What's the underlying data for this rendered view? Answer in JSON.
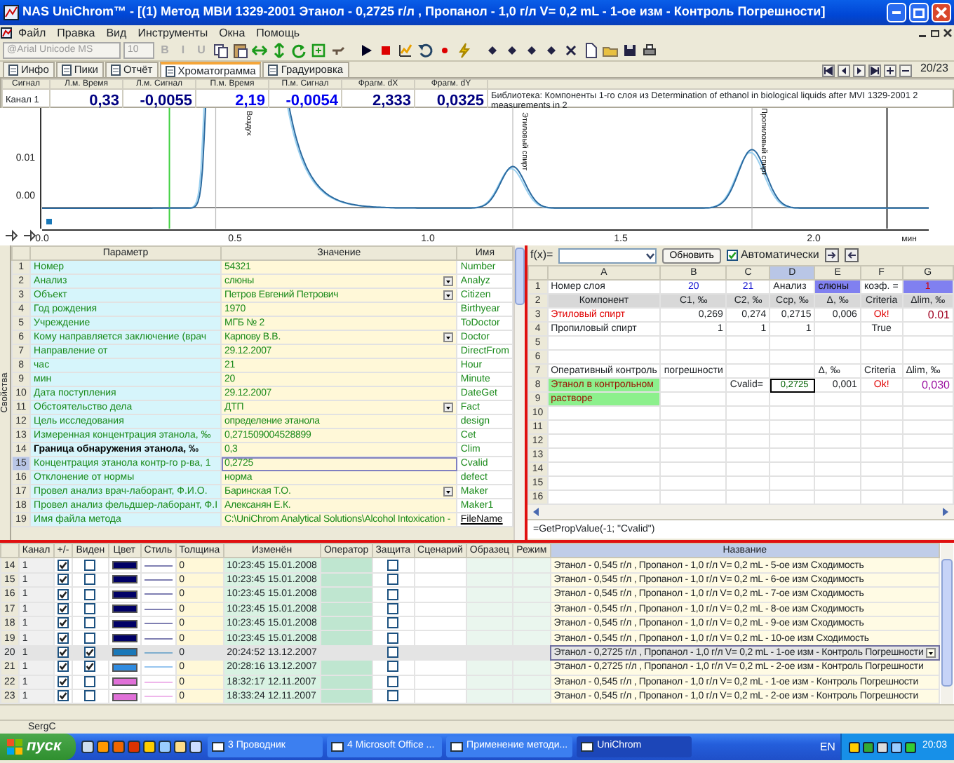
{
  "window": {
    "title": "NAS UniChrom™ - [(1) Метод МВИ 1329-2001   Этанол - 0,2725 г/л , Пропанол - 1,0 г/л V= 0,2 mL - 1-ое изм - Контроль Погрешности]"
  },
  "menu": [
    "Файл",
    "Правка",
    "Вид",
    "Инструменты",
    "Окна",
    "Помощь"
  ],
  "toolbar": {
    "font": "@Arial Unicode MS",
    "size": "10",
    "format_buttons": [
      "B",
      "I",
      "U"
    ]
  },
  "tabs": [
    {
      "label": "Инфо",
      "selected": false
    },
    {
      "label": "Пики",
      "selected": false
    },
    {
      "label": "Отчёт",
      "selected": false
    },
    {
      "label": "Хроматограмма",
      "selected": true
    },
    {
      "label": "Градуировка",
      "selected": false
    }
  ],
  "counter": "20/23",
  "readout": {
    "label_header": "Сигнал",
    "label": "Канал 1",
    "cells": [
      {
        "header": "Л.м. Время",
        "value": "0,33",
        "kind": "left"
      },
      {
        "header": "Л.м. Сигнал",
        "value": "-0,0055",
        "kind": "left"
      },
      {
        "header": "П.м. Время",
        "value": "2,19",
        "kind": "right"
      },
      {
        "header": "П.м. Сигнал",
        "value": "-0,0054",
        "kind": "right"
      },
      {
        "header": "Фрагм. dX",
        "value": "2,333",
        "kind": "left"
      },
      {
        "header": "Фрагм. dY",
        "value": "0,0325",
        "kind": "left"
      }
    ],
    "library": "Библиотека: Компоненты 1-го слоя из Determination of ethanol in biological liquids after MVI 1329-2001 2 measurements in 2"
  },
  "chromatogram": {
    "y_ticks": [
      "0.01",
      "0.00"
    ],
    "x_ticks": [
      "0.0",
      "0.5",
      "1.0",
      "1.5",
      "2.0"
    ],
    "x_unit": "мин",
    "peaks": [
      "Воздух",
      "Этиловый спирт",
      "Пропиловый спирт"
    ]
  },
  "properties": {
    "side_label": "Свойства",
    "columns": [
      "Параметр",
      "Значение",
      "Имя"
    ],
    "rows": [
      {
        "num": "1",
        "param": "Номер",
        "value": "54321",
        "name": "Number",
        "dropdown": false,
        "selected": false,
        "emphasized": false,
        "link": false
      },
      {
        "num": "2",
        "param": "Анализ",
        "value": "слюны",
        "name": "Analyz",
        "dropdown": true,
        "selected": false,
        "emphasized": false,
        "link": false
      },
      {
        "num": "3",
        "param": "Объект",
        "value": "Петров Евгений Петрович",
        "name": "Citizen",
        "dropdown": true,
        "selected": false,
        "emphasized": false,
        "link": false
      },
      {
        "num": "4",
        "param": "Год рождения",
        "value": "1970",
        "name": "Birthyear",
        "dropdown": false,
        "selected": false,
        "emphasized": false,
        "link": false
      },
      {
        "num": "5",
        "param": "Учреждение",
        "value": "МГБ № 2",
        "name": "ToDoctor",
        "dropdown": false,
        "selected": false,
        "emphasized": false,
        "link": false
      },
      {
        "num": "6",
        "param": "Кому направляется заключение (врач",
        "value": "Карпову В.В.",
        "name": "Doctor",
        "dropdown": true,
        "selected": false,
        "emphasized": false,
        "link": false
      },
      {
        "num": "7",
        "param": "Направление от",
        "value": "29.12.2007",
        "name": "DirectFrom",
        "dropdown": false,
        "selected": false,
        "emphasized": false,
        "link": false
      },
      {
        "num": "8",
        "param": "час",
        "value": "21",
        "name": "Hour",
        "dropdown": false,
        "selected": false,
        "emphasized": false,
        "link": false
      },
      {
        "num": "9",
        "param": "мин",
        "value": "20",
        "name": "Minute",
        "dropdown": false,
        "selected": false,
        "emphasized": false,
        "link": false
      },
      {
        "num": "10",
        "param": "Дата поступления",
        "value": "29.12.2007",
        "name": "DateGet",
        "dropdown": false,
        "selected": false,
        "emphasized": false,
        "link": false
      },
      {
        "num": "11",
        "param": "Обстоятельство дела",
        "value": "ДТП",
        "name": "Fact",
        "dropdown": true,
        "selected": false,
        "emphasized": false,
        "link": false
      },
      {
        "num": "12",
        "param": "Цель исследования",
        "value": "определение этанола",
        "name": "design",
        "dropdown": false,
        "selected": false,
        "emphasized": false,
        "link": false
      },
      {
        "num": "13",
        "param": "Измеренная концентрация этанола, ‰",
        "value": "0,271509004528899",
        "name": "Cet",
        "dropdown": false,
        "selected": false,
        "emphasized": false,
        "link": false
      },
      {
        "num": "14",
        "param": "Граница обнаружения этанола, ‰",
        "value": "0,3",
        "name": "Clim",
        "dropdown": false,
        "selected": false,
        "emphasized": true,
        "link": false
      },
      {
        "num": "15",
        "param": "Концентрация этанола контр-го р-ва, 1",
        "value": "0,2725",
        "name": "Cvalid",
        "dropdown": false,
        "selected": true,
        "emphasized": false,
        "link": false
      },
      {
        "num": "16",
        "param": "Отклонение от нормы",
        "value": "норма",
        "name": "defect",
        "dropdown": false,
        "selected": false,
        "emphasized": false,
        "link": false
      },
      {
        "num": "17",
        "param": "Провел анализ врач-лаборант, Ф.И.О.",
        "value": "Баринская Т.О.",
        "name": "Maker",
        "dropdown": true,
        "selected": false,
        "emphasized": false,
        "link": false
      },
      {
        "num": "18",
        "param": "Провел анализ фельдшер-лаборант, Ф.І",
        "value": "Алексанян Е.К.",
        "name": "Maker1",
        "dropdown": false,
        "selected": false,
        "emphasized": false,
        "link": false
      },
      {
        "num": "19",
        "param": "Имя файла метода",
        "value": "C:\\UniChrom Analytical Solutions\\Alcohol Intoxication -",
        "name": "FileName",
        "dropdown": false,
        "selected": false,
        "emphasized": false,
        "link": true
      }
    ]
  },
  "sheet": {
    "fx_label": "f(x)=",
    "refresh": "Обновить",
    "auto": {
      "label": "Автоматически",
      "checked": true
    },
    "columns": [
      {
        "label": "A",
        "selected": false
      },
      {
        "label": "B",
        "selected": false
      },
      {
        "label": "C",
        "selected": false
      },
      {
        "label": "D",
        "selected": true
      },
      {
        "label": "E",
        "selected": false
      },
      {
        "label": "F",
        "selected": false
      },
      {
        "label": "G",
        "selected": false
      }
    ],
    "rows": [
      {
        "num": "1",
        "cells": [
          {
            "text": "Номер слоя",
            "kind": "text"
          },
          {
            "text": "20",
            "kind": "id"
          },
          {
            "text": "21",
            "kind": "id"
          },
          {
            "text": "Анализ",
            "kind": "text"
          },
          {
            "text": "слюны",
            "kind": "analysis"
          },
          {
            "text": "коэф. =",
            "kind": "text"
          },
          {
            "text": "1",
            "kind": "coef"
          }
        ]
      },
      {
        "num": "2",
        "cells": [
          {
            "text": "Компонент",
            "kind": "head"
          },
          {
            "text": "C1, ‰",
            "kind": "head"
          },
          {
            "text": "C2, ‰",
            "kind": "head"
          },
          {
            "text": "Cср, ‰",
            "kind": "head"
          },
          {
            "text": "Δ, ‰",
            "kind": "head"
          },
          {
            "text": "Criteria",
            "kind": "head"
          },
          {
            "text": "Δlim, ‰",
            "kind": "head"
          }
        ]
      },
      {
        "num": "3",
        "cells": [
          {
            "text": "Этиловый спирт",
            "kind": "alert"
          },
          {
            "text": "0,269",
            "kind": "num"
          },
          {
            "text": "0,274",
            "kind": "num"
          },
          {
            "text": "0,2715",
            "kind": "num"
          },
          {
            "text": "0,006",
            "kind": "num"
          },
          {
            "text": "Ok!",
            "kind": "ok"
          },
          {
            "text": "0.01",
            "kind": "limit"
          }
        ]
      },
      {
        "num": "4",
        "cells": [
          {
            "text": "Пропиловый спирт",
            "kind": "text"
          },
          {
            "text": "1",
            "kind": "num"
          },
          {
            "text": "1",
            "kind": "num"
          },
          {
            "text": "1",
            "kind": "num"
          },
          {},
          {
            "text": "True",
            "kind": "center"
          },
          {}
        ]
      },
      {
        "num": "5",
        "cells": []
      },
      {
        "num": "6",
        "cells": []
      },
      {
        "num": "7",
        "cells": [
          {
            "text": "Оперативный контроль",
            "kind": "bold"
          },
          {
            "text": "погрешности",
            "kind": "bold"
          },
          {},
          {},
          {
            "text": "Δ, ‰",
            "kind": "bold"
          },
          {
            "text": "Criteria",
            "kind": "bold"
          },
          {
            "text": "Δlim, ‰",
            "kind": "bold"
          }
        ]
      },
      {
        "num": "8",
        "cells": [
          {
            "text": "Этанол в контрольном",
            "kind": "control"
          },
          {},
          {
            "text": "Cvalid=",
            "kind": "text"
          },
          {
            "text": "0,2725",
            "kind": "current"
          },
          {
            "text": "0,001",
            "kind": "num"
          },
          {
            "text": "Ok!",
            "kind": "ok"
          },
          {
            "text": "0,030",
            "kind": "limit2"
          }
        ]
      },
      {
        "num": "9",
        "cells": [
          {
            "text": "растворе",
            "kind": "control"
          }
        ]
      },
      {
        "num": "10",
        "cells": []
      },
      {
        "num": "11",
        "cells": []
      },
      {
        "num": "12",
        "cells": []
      },
      {
        "num": "13",
        "cells": []
      },
      {
        "num": "14",
        "cells": []
      },
      {
        "num": "15",
        "cells": []
      },
      {
        "num": "16",
        "cells": []
      }
    ],
    "formula": "=GetPropValue(-1; \"Cvalid\")"
  },
  "runs": {
    "columns": [
      "Канал",
      "+/-",
      "Виден",
      "Цвет",
      "Стиль",
      "Толщина",
      "Изменён",
      "Оператор",
      "Защита",
      "Сценарий",
      "Образец",
      "Режим",
      "Название"
    ],
    "rows": [
      {
        "num": "14",
        "channel": "1",
        "plus": true,
        "visible": false,
        "color": "#000066",
        "thickness": "0",
        "modified": "10:23:45 15.01.2008",
        "protected": false,
        "name": "Этанол - 0,545 г/л , Пропанол - 1,0 г/л V= 0,2 mL - 5-ое изм Сходимость",
        "selected": false
      },
      {
        "num": "15",
        "channel": "1",
        "plus": true,
        "visible": false,
        "color": "#000066",
        "thickness": "0",
        "modified": "10:23:45 15.01.2008",
        "protected": false,
        "name": "Этанол - 0,545 г/л , Пропанол - 1,0 г/л V= 0,2 mL - 6-ое изм Сходимость",
        "selected": false
      },
      {
        "num": "16",
        "channel": "1",
        "plus": true,
        "visible": false,
        "color": "#000066",
        "thickness": "0",
        "modified": "10:23:45 15.01.2008",
        "protected": false,
        "name": "Этанол - 0,545 г/л , Пропанол - 1,0 г/л V= 0,2 mL - 7-ое изм Сходимость",
        "selected": false
      },
      {
        "num": "17",
        "channel": "1",
        "plus": true,
        "visible": false,
        "color": "#000066",
        "thickness": "0",
        "modified": "10:23:45 15.01.2008",
        "protected": false,
        "name": "Этанол - 0,545 г/л , Пропанол - 1,0 г/л V= 0,2 mL - 8-ое изм Сходимость",
        "selected": false
      },
      {
        "num": "18",
        "channel": "1",
        "plus": true,
        "visible": false,
        "color": "#000066",
        "thickness": "0",
        "modified": "10:23:45 15.01.2008",
        "protected": false,
        "name": "Этанол - 0,545 г/л , Пропанол - 1,0 г/л V= 0,2 mL - 9-ое изм Сходимость",
        "selected": false
      },
      {
        "num": "19",
        "channel": "1",
        "plus": true,
        "visible": false,
        "color": "#000066",
        "thickness": "0",
        "modified": "10:23:45 15.01.2008",
        "protected": false,
        "name": "Этанол - 0,545 г/л , Пропанол - 1,0 г/л V= 0,2 mL - 10-ое изм Сходимость",
        "selected": false
      },
      {
        "num": "20",
        "channel": "1",
        "plus": true,
        "visible": true,
        "color": "#1a78b8",
        "thickness": "0",
        "modified": "20:24:52 13.12.2007",
        "protected": false,
        "name": "Этанол - 0,2725 г/л , Пропанол - 1,0 г/л V= 0,2 mL - 1-ое изм - Контроль Погрешности",
        "selected": true
      },
      {
        "num": "21",
        "channel": "1",
        "plus": true,
        "visible": true,
        "color": "#2f8be0",
        "thickness": "0",
        "modified": "20:28:16 13.12.2007",
        "protected": false,
        "name": "Этанол - 0,2725 г/л , Пропанол - 1,0 г/л V= 0,2 mL - 2-ое изм - Контроль Погрешности",
        "selected": false
      },
      {
        "num": "22",
        "channel": "1",
        "plus": true,
        "visible": false,
        "color": "#e070d8",
        "thickness": "0",
        "modified": "18:32:17 12.11.2007",
        "protected": false,
        "name": "Этанол - 0,545 г/л , Пропанол - 1,0 г/л V= 0,2 mL - 1-ое изм - Контроль Погрешности",
        "selected": false
      },
      {
        "num": "23",
        "channel": "1",
        "plus": true,
        "visible": false,
        "color": "#e070d8",
        "thickness": "0",
        "modified": "18:33:24 12.11.2007",
        "protected": false,
        "name": "Этанол - 0,545 г/л , Пропанол - 1,0 г/л V= 0,2 mL - 2-ое изм - Контроль Погрешности",
        "selected": false
      }
    ]
  },
  "status_bar": "SergC",
  "taskbar": {
    "start": "пуск",
    "tasks": [
      {
        "label": "3 Проводник",
        "active": false
      },
      {
        "label": "4 Microsoft Office ...",
        "active": false
      },
      {
        "label": "Применение методи...",
        "active": false
      },
      {
        "label": "UniChrom",
        "active": true
      }
    ],
    "language": "EN",
    "clock": "20:03"
  }
}
